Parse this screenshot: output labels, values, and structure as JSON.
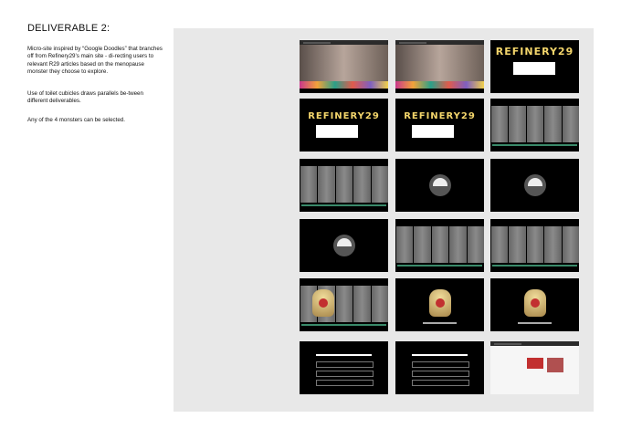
{
  "heading": "DELIVERABLE 2:",
  "paragraphs": [
    "Micro-site inspired by “Google Doodles” that branches off from Refinery29’s main site - di-recting users to relevant R29 articles based on the menopause monster they choose to explore.",
    "Use of toilet cubicles draws parallels be-tween different deliverables.",
    "Any of the 4 monsters can be selected."
  ],
  "thumbnails": {
    "logo_text": "REFINERY29",
    "types": [
      "site-hero",
      "site-hero",
      "logo-intro",
      "logo-intro",
      "logo-intro",
      "cubicles",
      "cubicles",
      "gauge",
      "gauge",
      "gauge",
      "cubicles",
      "cubicles",
      "monster-cubicles",
      "monster",
      "monster",
      "quiz",
      "quiz",
      "article"
    ]
  },
  "colors": {
    "panel": "#e8e8e8",
    "thumb_bg": "#000000"
  }
}
